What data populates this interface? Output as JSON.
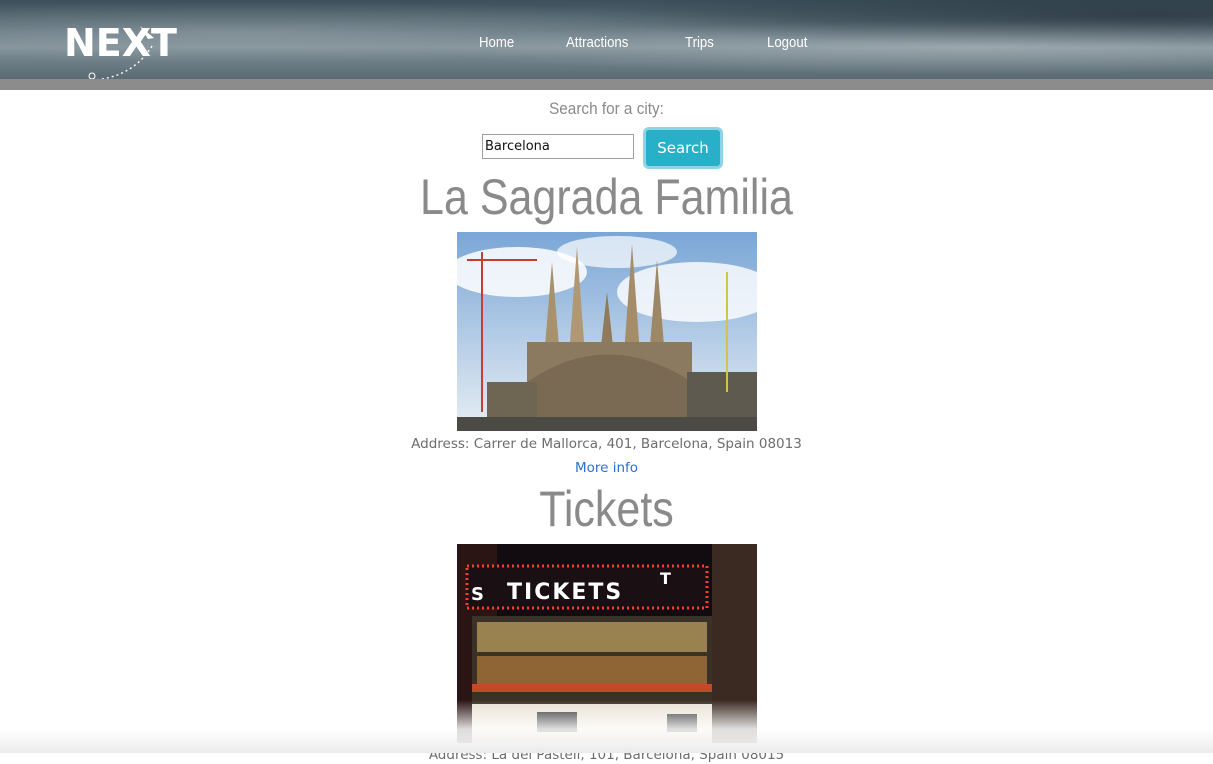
{
  "header": {
    "logo_text": "NEXT",
    "nav": [
      {
        "label": "Home"
      },
      {
        "label": "Attractions"
      },
      {
        "label": "Trips"
      },
      {
        "label": "Logout"
      }
    ]
  },
  "search": {
    "label": "Search for a city:",
    "value": "Barcelona",
    "button_label": "Search"
  },
  "attractions": [
    {
      "title": "La Sagrada Familia",
      "image": "sagrada-familia-photo",
      "address": "Address: Carrer de Mallorca, 401, Barcelona, Spain 08013",
      "link_label": "More info"
    },
    {
      "title": "Tickets",
      "image": "tickets-booth-photo",
      "address": "Address: La del Pastell, 101, Barcelona, Spain 08015"
    }
  ],
  "colors": {
    "accent_button": "#27b0c8",
    "link": "#2a6fd6",
    "title_grey": "#8a8a8a"
  }
}
